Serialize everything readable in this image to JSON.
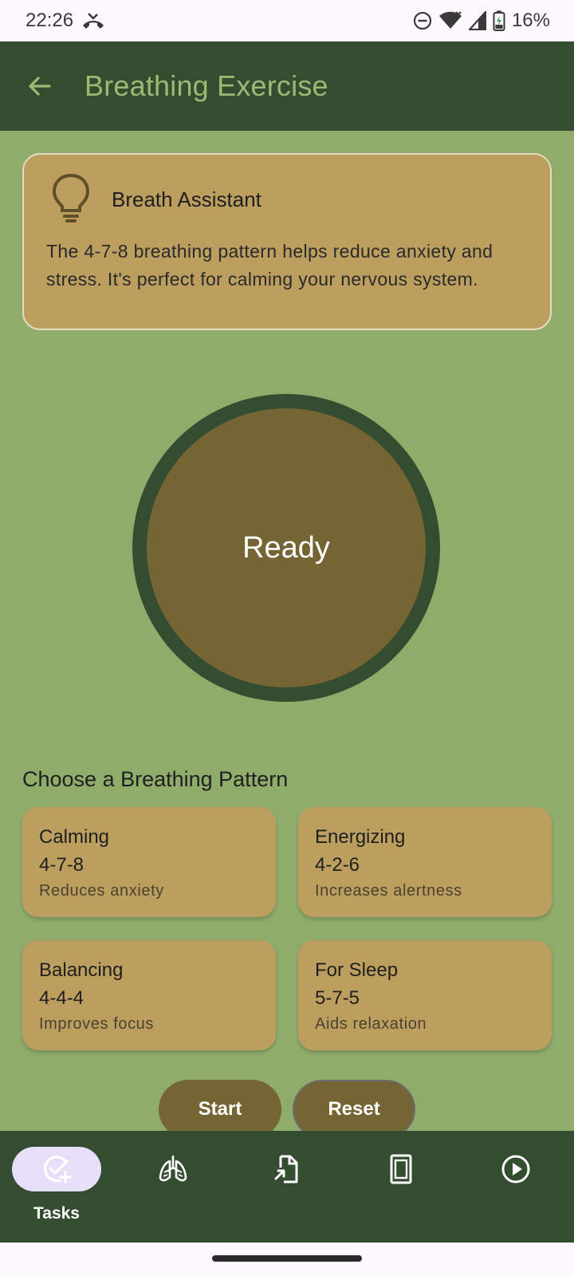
{
  "status_bar": {
    "time": "22:26",
    "battery_percent": "16%",
    "icons": [
      "missed-call-icon",
      "do-not-disturb-icon",
      "wifi-icon",
      "signal-icon",
      "battery-charging-icon"
    ]
  },
  "app_bar": {
    "title": "Breathing Exercise",
    "back_icon": "arrow-back-icon"
  },
  "assistant": {
    "icon": "lightbulb-icon",
    "title": "Breath Assistant",
    "text": "The 4-7-8 breathing pattern helps reduce anxiety and stress. It's perfect for calming your nervous system."
  },
  "breath": {
    "state": "Ready"
  },
  "patterns": {
    "section_title": "Choose a Breathing Pattern",
    "items": [
      {
        "name": "Calming",
        "ratio": "4-7-8",
        "desc": "Reduces anxiety"
      },
      {
        "name": "Energizing",
        "ratio": "4-2-6",
        "desc": "Increases alertness"
      },
      {
        "name": "Balancing",
        "ratio": "4-4-4",
        "desc": "Improves focus"
      },
      {
        "name": "For Sleep",
        "ratio": "5-7-5",
        "desc": "Aids relaxation"
      }
    ]
  },
  "controls": {
    "start_label": "Start",
    "reset_label": "Reset"
  },
  "bottom_nav": {
    "items": [
      {
        "label": "Tasks",
        "icon": "task-add-icon",
        "active": true
      },
      {
        "label": "",
        "icon": "lungs-icon",
        "active": false
      },
      {
        "label": "",
        "icon": "document-export-icon",
        "active": false
      },
      {
        "label": "",
        "icon": "tablet-icon",
        "active": false
      },
      {
        "label": "",
        "icon": "play-circle-icon",
        "active": false
      }
    ]
  },
  "colors": {
    "app_bar": "#344c30",
    "background": "#8fac6b",
    "card": "#bc9e5f",
    "accent": "#756534",
    "title_text": "#9bba73"
  }
}
